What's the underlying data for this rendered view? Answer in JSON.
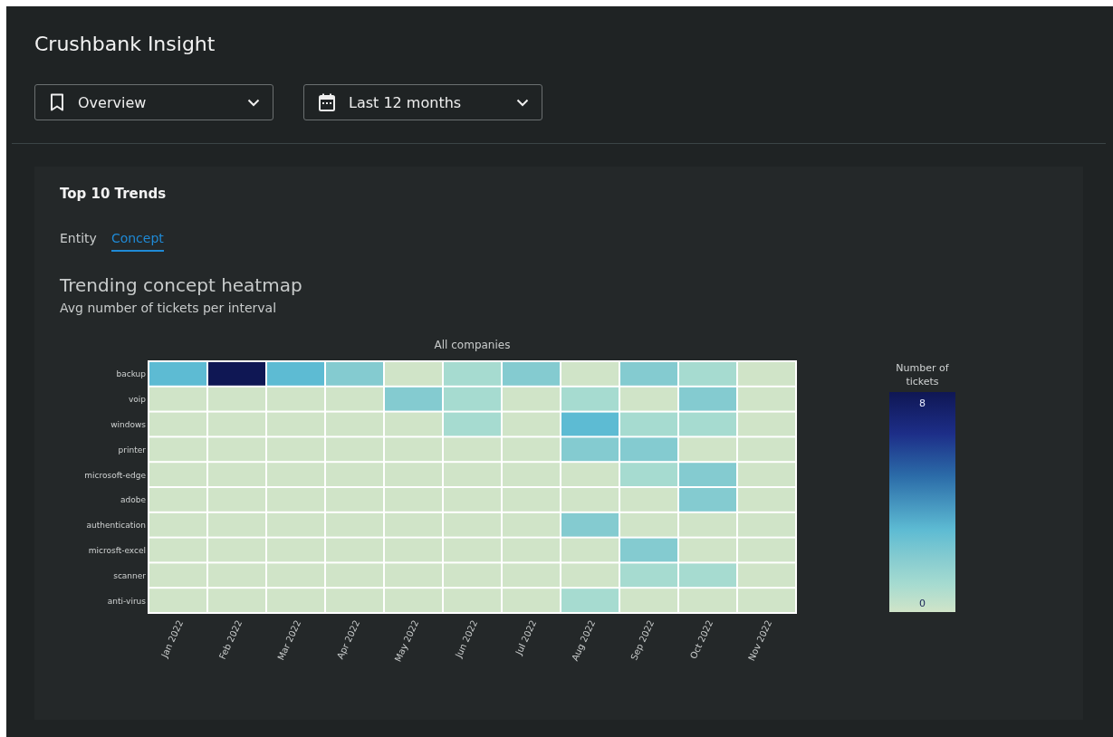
{
  "app": {
    "title": "Crushbank Insight"
  },
  "filters": [
    {
      "kind": "bookmark",
      "value": "Overview"
    },
    {
      "kind": "calendar",
      "value": "Last 12 months"
    }
  ],
  "card": {
    "title": "Top 10 Trends",
    "tabs": [
      {
        "label": "Entity",
        "selected": false
      },
      {
        "label": "Concept",
        "selected": true
      }
    ],
    "heading": "Trending concept heatmap",
    "subtitle": "Avg number of tickets per interval",
    "heatmap": {
      "title": "All companies",
      "columns": [
        "Jan 2022",
        "Feb 2022",
        "Mar 2022",
        "Apr 2022",
        "May 2022",
        "Jun 2022",
        "Jul 2022",
        "Aug 2022",
        "Sep 2022",
        "Oct 2022",
        "Nov 2022"
      ],
      "rows": [
        {
          "label": "backup",
          "cells": [
            {
              "color": "#5dbbd3"
            },
            {
              "color": "#0f1754"
            },
            {
              "color": "#5dbbd3"
            },
            {
              "color": "#84cbd0"
            },
            {
              "color": "#d0e4c8"
            },
            {
              "color": "#a6dbd0"
            },
            {
              "color": "#84cbd0"
            },
            {
              "color": "#d0e4c8"
            },
            {
              "color": "#84cbd0"
            },
            {
              "color": "#a6dbd0"
            },
            {
              "color": "#d0e4c8"
            }
          ]
        },
        {
          "label": "voip",
          "cells": [
            {
              "color": "#d0e4c8"
            },
            {
              "color": "#d0e4c8"
            },
            {
              "color": "#d0e4c8"
            },
            {
              "color": "#d0e4c8"
            },
            {
              "color": "#84cbd0"
            },
            {
              "color": "#a6dbd0"
            },
            {
              "color": "#d0e4c8"
            },
            {
              "color": "#a6dbd0"
            },
            {
              "color": "#d0e4c8"
            },
            {
              "color": "#84cbd0"
            },
            {
              "color": "#d0e4c8"
            }
          ]
        },
        {
          "label": "windows",
          "cells": [
            {
              "color": "#d0e4c8"
            },
            {
              "color": "#d0e4c8"
            },
            {
              "color": "#d0e4c8"
            },
            {
              "color": "#d0e4c8"
            },
            {
              "color": "#d0e4c8"
            },
            {
              "color": "#a6dbd0"
            },
            {
              "color": "#d0e4c8"
            },
            {
              "color": "#5dbbd3"
            },
            {
              "color": "#a6dbd0"
            },
            {
              "color": "#a6dbd0"
            },
            {
              "color": "#d0e4c8"
            }
          ]
        },
        {
          "label": "printer",
          "cells": [
            {
              "color": "#d0e4c8"
            },
            {
              "color": "#d0e4c8"
            },
            {
              "color": "#d0e4c8"
            },
            {
              "color": "#d0e4c8"
            },
            {
              "color": "#d0e4c8"
            },
            {
              "color": "#d0e4c8"
            },
            {
              "color": "#d0e4c8"
            },
            {
              "color": "#84cbd0"
            },
            {
              "color": "#84cbd0"
            },
            {
              "color": "#d0e4c8"
            },
            {
              "color": "#d0e4c8"
            }
          ]
        },
        {
          "label": "microsoft-edge",
          "cells": [
            {
              "color": "#d0e4c8"
            },
            {
              "color": "#d0e4c8"
            },
            {
              "color": "#d0e4c8"
            },
            {
              "color": "#d0e4c8"
            },
            {
              "color": "#d0e4c8"
            },
            {
              "color": "#d0e4c8"
            },
            {
              "color": "#d0e4c8"
            },
            {
              "color": "#d0e4c8"
            },
            {
              "color": "#a6dbd0"
            },
            {
              "color": "#84cbd0"
            },
            {
              "color": "#d0e4c8"
            }
          ]
        },
        {
          "label": "adobe",
          "cells": [
            {
              "color": "#d0e4c8"
            },
            {
              "color": "#d0e4c8"
            },
            {
              "color": "#d0e4c8"
            },
            {
              "color": "#d0e4c8"
            },
            {
              "color": "#d0e4c8"
            },
            {
              "color": "#d0e4c8"
            },
            {
              "color": "#d0e4c8"
            },
            {
              "color": "#d0e4c8"
            },
            {
              "color": "#d0e4c8"
            },
            {
              "color": "#84cbd0"
            },
            {
              "color": "#d0e4c8"
            }
          ]
        },
        {
          "label": "authentication",
          "cells": [
            {
              "color": "#d0e4c8"
            },
            {
              "color": "#d0e4c8"
            },
            {
              "color": "#d0e4c8"
            },
            {
              "color": "#d0e4c8"
            },
            {
              "color": "#d0e4c8"
            },
            {
              "color": "#d0e4c8"
            },
            {
              "color": "#d0e4c8"
            },
            {
              "color": "#84cbd0"
            },
            {
              "color": "#d0e4c8"
            },
            {
              "color": "#d0e4c8"
            },
            {
              "color": "#d0e4c8"
            }
          ]
        },
        {
          "label": "microsft-excel",
          "cells": [
            {
              "color": "#d0e4c8"
            },
            {
              "color": "#d0e4c8"
            },
            {
              "color": "#d0e4c8"
            },
            {
              "color": "#d0e4c8"
            },
            {
              "color": "#d0e4c8"
            },
            {
              "color": "#d0e4c8"
            },
            {
              "color": "#d0e4c8"
            },
            {
              "color": "#d0e4c8"
            },
            {
              "color": "#84cbd0"
            },
            {
              "color": "#d0e4c8"
            },
            {
              "color": "#d0e4c8"
            }
          ]
        },
        {
          "label": "scanner",
          "cells": [
            {
              "color": "#d0e4c8"
            },
            {
              "color": "#d0e4c8"
            },
            {
              "color": "#d0e4c8"
            },
            {
              "color": "#d0e4c8"
            },
            {
              "color": "#d0e4c8"
            },
            {
              "color": "#d0e4c8"
            },
            {
              "color": "#d0e4c8"
            },
            {
              "color": "#d0e4c8"
            },
            {
              "color": "#a6dbd0"
            },
            {
              "color": "#a6dbd0"
            },
            {
              "color": "#d0e4c8"
            }
          ]
        },
        {
          "label": "anti-virus",
          "cells": [
            {
              "color": "#d0e4c8"
            },
            {
              "color": "#d0e4c8"
            },
            {
              "color": "#d0e4c8"
            },
            {
              "color": "#d0e4c8"
            },
            {
              "color": "#d0e4c8"
            },
            {
              "color": "#d0e4c8"
            },
            {
              "color": "#d0e4c8"
            },
            {
              "color": "#a6dbd0"
            },
            {
              "color": "#d0e4c8"
            },
            {
              "color": "#d0e4c8"
            },
            {
              "color": "#d0e4c8"
            }
          ]
        }
      ],
      "legend": {
        "title": "Number of tickets",
        "max_label": "8",
        "min_label": "0"
      }
    }
  }
}
